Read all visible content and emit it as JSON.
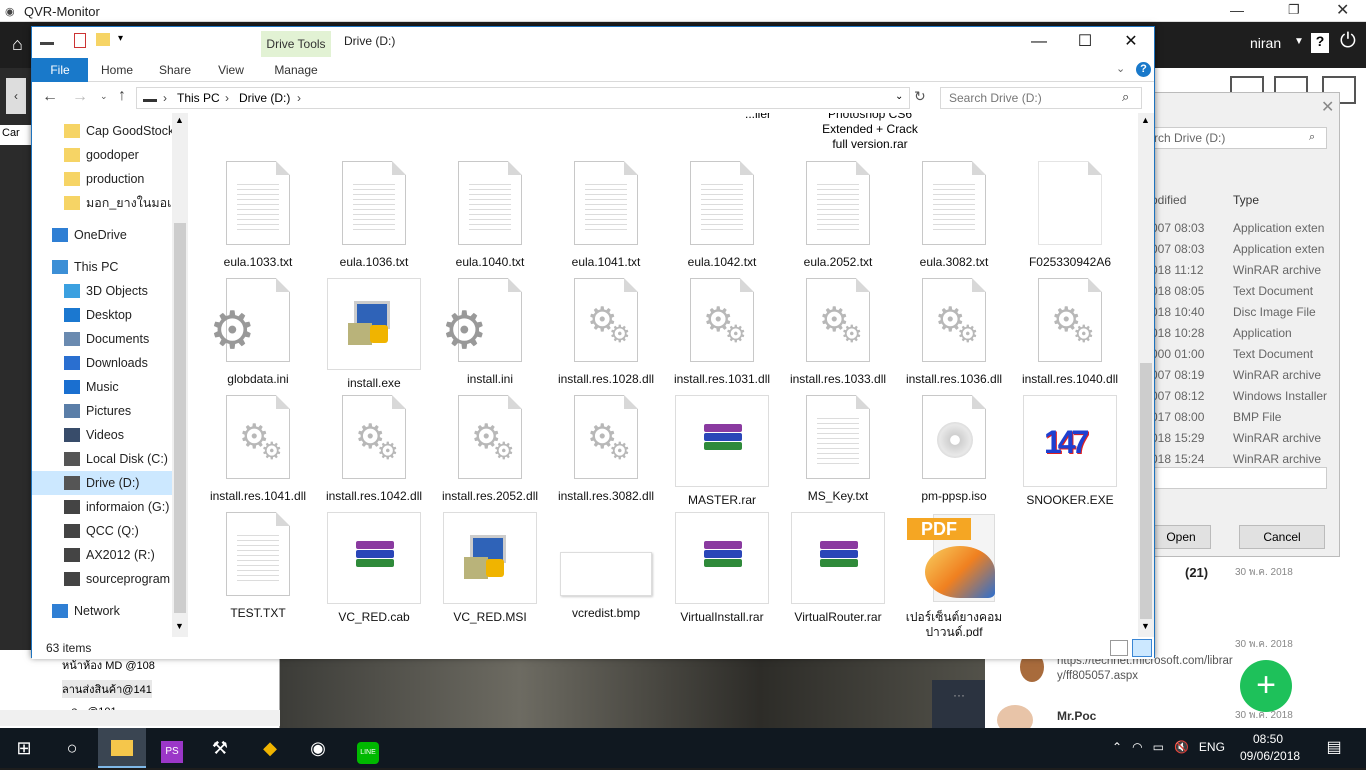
{
  "qvr": {
    "title": "QVR-Monitor",
    "user": "niran",
    "tree_items": [
      "หน้าห้อง MD @108",
      "ลานส่งสินค้า@141",
      "...ล...@101"
    ],
    "chat_items": [
      {
        "time": "30 พ.ค. 2018",
        "count": "(21)"
      },
      {
        "time": "30 พ.ค. 2018",
        "text": "https://technet.microsoft.com/library/ff805057.aspx"
      },
      {
        "time": "30 พ.ค. 2018",
        "name": "Mr.Poc"
      }
    ]
  },
  "bg_dialog": {
    "search_placeholder": "rch Drive (D:)",
    "col_modified": "odified",
    "col_type": "Type",
    "rows": [
      [
        "007 08:03",
        "Application exten"
      ],
      [
        "007 08:03",
        "Application exten"
      ],
      [
        "018 11:12",
        "WinRAR archive"
      ],
      [
        "018 08:05",
        "Text Document"
      ],
      [
        "018 10:40",
        "Disc Image File"
      ],
      [
        "018 10:28",
        "Application"
      ],
      [
        "000 01:00",
        "Text Document"
      ],
      [
        "007 08:19",
        "WinRAR archive"
      ],
      [
        "007 08:12",
        "Windows Installer"
      ],
      [
        "017 08:00",
        "BMP File"
      ],
      [
        "018 15:29",
        "WinRAR archive"
      ],
      [
        "018 15:24",
        "WinRAR archive"
      ]
    ],
    "open_label": "Open",
    "cancel_label": "Cancel"
  },
  "explorer": {
    "title": "Drive (D:)",
    "context_tab": "Drive Tools",
    "tabs": [
      "File",
      "Home",
      "Share",
      "View",
      "Manage"
    ],
    "breadcrumb": [
      "This PC",
      "Drive (D:)"
    ],
    "search_placeholder": "Search Drive (D:)",
    "nav_items": [
      {
        "label": "Cap GoodStock",
        "icon": "folder-icon"
      },
      {
        "label": "goodoper",
        "icon": "folder-icon"
      },
      {
        "label": "production",
        "icon": "folder-icon"
      },
      {
        "label": "มอก_ยางในมอเตอร์",
        "icon": "folder-icon"
      },
      {
        "label": "OneDrive",
        "icon": "cloud-icon"
      },
      {
        "label": "This PC",
        "icon": "computer-icon"
      },
      {
        "label": "3D Objects",
        "icon": "cube-icon"
      },
      {
        "label": "Desktop",
        "icon": "desktop-icon"
      },
      {
        "label": "Documents",
        "icon": "documents-icon"
      },
      {
        "label": "Downloads",
        "icon": "download-icon"
      },
      {
        "label": "Music",
        "icon": "music-icon"
      },
      {
        "label": "Pictures",
        "icon": "pictures-icon"
      },
      {
        "label": "Videos",
        "icon": "videos-icon"
      },
      {
        "label": "Local Disk (C:)",
        "icon": "drive-icon"
      },
      {
        "label": "Drive (D:)",
        "icon": "drive-icon"
      },
      {
        "label": "informaion (G:)",
        "icon": "network-drive-icon"
      },
      {
        "label": "QCC (Q:)",
        "icon": "network-drive-icon"
      },
      {
        "label": "AX2012 (R:)",
        "icon": "network-drive-icon"
      },
      {
        "label": "sourceprogram (",
        "icon": "network-drive-icon"
      },
      {
        "label": "Network",
        "icon": "network-icon"
      }
    ],
    "partial_top": [
      "...ller",
      "Photoshop CS6\nExtended + Crack\nfull version.rar"
    ],
    "files": [
      {
        "name": "eula.1033.txt",
        "kind": "txt"
      },
      {
        "name": "eula.1036.txt",
        "kind": "txt"
      },
      {
        "name": "eula.1040.txt",
        "kind": "txt"
      },
      {
        "name": "eula.1041.txt",
        "kind": "txt"
      },
      {
        "name": "eula.1042.txt",
        "kind": "txt"
      },
      {
        "name": "eula.2052.txt",
        "kind": "txt"
      },
      {
        "name": "eula.3082.txt",
        "kind": "txt"
      },
      {
        "name": "F025330942A6",
        "kind": "blank"
      },
      {
        "name": "globdata.ini",
        "kind": "ini"
      },
      {
        "name": "install.exe",
        "kind": "setup"
      },
      {
        "name": "install.ini",
        "kind": "ini"
      },
      {
        "name": "install.res.1028.dll",
        "kind": "dll"
      },
      {
        "name": "install.res.1031.dll",
        "kind": "dll"
      },
      {
        "name": "install.res.1033.dll",
        "kind": "dll"
      },
      {
        "name": "install.res.1036.dll",
        "kind": "dll"
      },
      {
        "name": "install.res.1040.dll",
        "kind": "dll"
      },
      {
        "name": "install.res.1041.dll",
        "kind": "dll"
      },
      {
        "name": "install.res.1042.dll",
        "kind": "dll"
      },
      {
        "name": "install.res.2052.dll",
        "kind": "dll"
      },
      {
        "name": "install.res.3082.dll",
        "kind": "dll"
      },
      {
        "name": "MASTER.rar",
        "kind": "rar"
      },
      {
        "name": "MS_Key.txt",
        "kind": "txt"
      },
      {
        "name": "pm-ppsp.iso",
        "kind": "iso"
      },
      {
        "name": "SNOOKER.EXE",
        "kind": "snooker"
      },
      {
        "name": "TEST.TXT",
        "kind": "txt"
      },
      {
        "name": "VC_RED.cab",
        "kind": "rar"
      },
      {
        "name": "VC_RED.MSI",
        "kind": "msi"
      },
      {
        "name": "vcredist.bmp",
        "kind": "bmp"
      },
      {
        "name": "VirtualInstall.rar",
        "kind": "rar"
      },
      {
        "name": "VirtualRouter.rar",
        "kind": "rar"
      },
      {
        "name": "เปอร์เซ็นต์ยางคอมปาวนด์.pdf",
        "kind": "pdf"
      }
    ],
    "status": "63 items",
    "pdf_badge": "PDF",
    "snooker_text": "147"
  },
  "taskbar": {
    "time": "08:50",
    "date": "09/06/2018",
    "lang": "ENG"
  }
}
